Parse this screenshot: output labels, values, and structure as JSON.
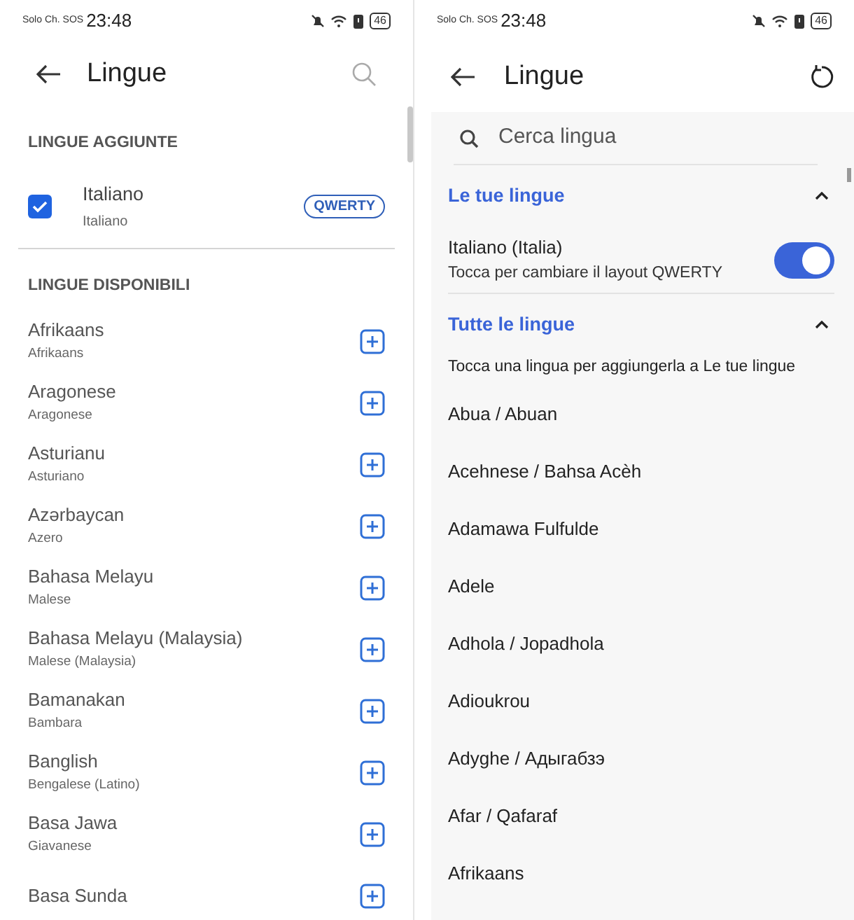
{
  "left_screen": {
    "status_bar": {
      "carrier": "Solo Ch. SOS",
      "time": "23:48",
      "battery": "46"
    },
    "title": "Lingue",
    "added_section": {
      "heading": "LINGUE AGGIUNTE",
      "items": [
        {
          "name": "Italiano",
          "subtitle": "Italiano",
          "checked": true,
          "layout": "QWERTY"
        }
      ]
    },
    "available_section": {
      "heading": "LINGUE DISPONIBILI",
      "items": [
        {
          "name": "Afrikaans",
          "subtitle": "Afrikaans"
        },
        {
          "name": "Aragonese",
          "subtitle": "Aragonese"
        },
        {
          "name": "Asturianu",
          "subtitle": "Asturiano"
        },
        {
          "name": "Azərbaycan",
          "subtitle": "Azero"
        },
        {
          "name": "Bahasa Melayu",
          "subtitle": "Malese"
        },
        {
          "name": "Bahasa Melayu (Malaysia)",
          "subtitle": "Malese (Malaysia)"
        },
        {
          "name": "Bamanakan",
          "subtitle": "Bambara"
        },
        {
          "name": "Banglish",
          "subtitle": "Bengalese (Latino)"
        },
        {
          "name": "Basa Jawa",
          "subtitle": "Giavanese"
        },
        {
          "name": "Basa Sunda"
        }
      ]
    }
  },
  "right_screen": {
    "status_bar": {
      "carrier": "Solo Ch. SOS",
      "time": "23:48",
      "battery": "46"
    },
    "title": "Lingue",
    "search": {
      "placeholder": "Cerca lingua"
    },
    "your_languages": {
      "heading": "Le tue lingue",
      "expanded": true,
      "items": [
        {
          "name": "Italiano (Italia)",
          "subtitle": "Tocca per cambiare il layout QWERTY",
          "on": true
        }
      ]
    },
    "all_languages": {
      "heading": "Tutte le lingue",
      "expanded": true,
      "hint": "Tocca una lingua per aggiungerla a Le tue lingue",
      "items": [
        "Abua / Abuan",
        "Acehnese / Bahsa Acèh",
        "Adamawa Fulfulde",
        "Adele",
        "Adhola / Jopadhola",
        "Adioukrou",
        "Adyghe / Адыгабзэ",
        "Afar / Qafaraf",
        "Afrikaans"
      ]
    }
  }
}
